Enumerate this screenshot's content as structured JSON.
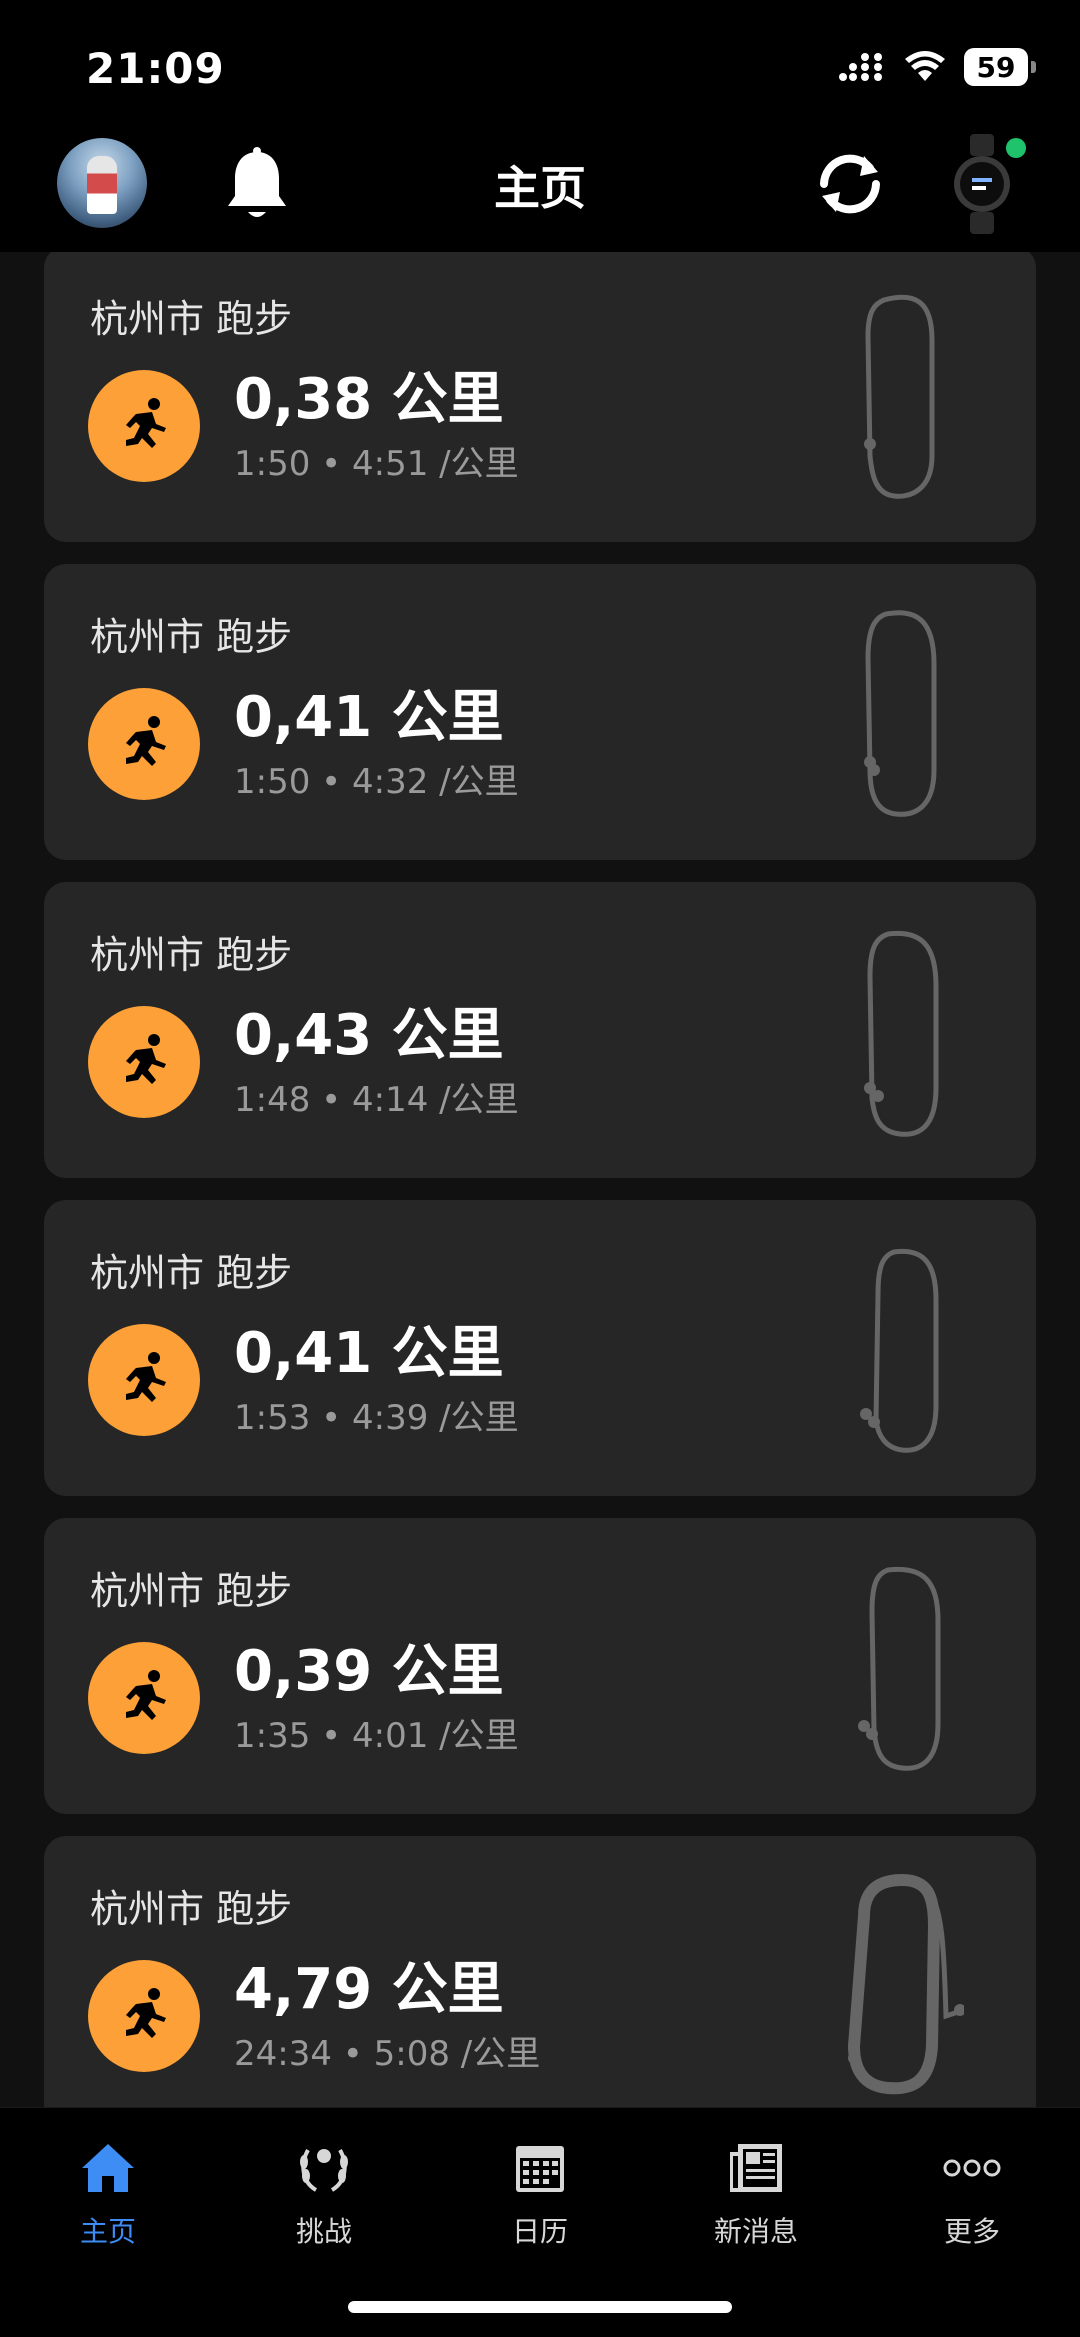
{
  "status_bar": {
    "time": "21:09",
    "battery": "59",
    "icons": [
      "signal-icon",
      "wifi-icon",
      "battery-icon"
    ]
  },
  "header": {
    "title": "主页",
    "icons": [
      "avatar",
      "bell-icon",
      "sync-icon",
      "watch-icon"
    ],
    "watch_status_color": "#1ec36b"
  },
  "activities": [
    {
      "title": "杭州市 跑步",
      "distance": "0,38 公里",
      "stats": "1:50 • 4:51 /公里"
    },
    {
      "title": "杭州市 跑步",
      "distance": "0,41 公里",
      "stats": "1:50 • 4:32 /公里"
    },
    {
      "title": "杭州市 跑步",
      "distance": "0,43 公里",
      "stats": "1:48 • 4:14 /公里"
    },
    {
      "title": "杭州市 跑步",
      "distance": "0,41 公里",
      "stats": "1:53 • 4:39 /公里"
    },
    {
      "title": "杭州市 跑步",
      "distance": "0,39 公里",
      "stats": "1:35 • 4:01 /公里"
    },
    {
      "title": "杭州市 跑步",
      "distance": "4,79 公里",
      "stats": "24:34 • 5:08 /公里"
    }
  ],
  "tab_bar": {
    "tabs": [
      {
        "label": "主页",
        "icon": "home-icon",
        "active": true
      },
      {
        "label": "挑战",
        "icon": "laurel-icon",
        "active": false
      },
      {
        "label": "日历",
        "icon": "calendar-icon",
        "active": false
      },
      {
        "label": "新消息",
        "icon": "newspaper-icon",
        "active": false
      },
      {
        "label": "更多",
        "icon": "more-icon",
        "active": false
      }
    ]
  },
  "colors": {
    "accent": "#3d8df5",
    "run_icon_bg": "#fca037",
    "card_bg": "#262626",
    "secondary_text": "#9a9a9a"
  }
}
